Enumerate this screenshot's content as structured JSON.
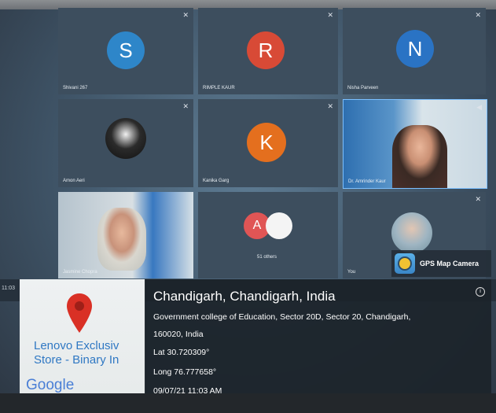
{
  "participants": [
    {
      "initial": "S",
      "name": "Shivani 267",
      "color": "#2e86c9"
    },
    {
      "initial": "R",
      "name": "RIMPLE KAUR",
      "color": "#d84a36"
    },
    {
      "initial": "N",
      "name": "Nisha Parveen",
      "color": "#2a73c4"
    },
    {
      "initial": "",
      "name": "Amon Aeri",
      "color": "#2b2b2b"
    },
    {
      "initial": "K",
      "name": "Kanika Garg",
      "color": "#e46f1e"
    },
    {
      "initial": "",
      "name": "Dr. Amrinder Kaur",
      "color": "#b0c4d6"
    },
    {
      "initial": "",
      "name": "Jasmine Chopra",
      "color": "#c8c0b0"
    },
    {
      "initial": "A",
      "name": "51 others",
      "color": "#e05555"
    },
    {
      "initial": "",
      "name": "You",
      "color": "#b9cbd6"
    }
  ],
  "gps": {
    "app_name": "GPS Map Camera",
    "city": "Chandigarh, Chandigarh, India",
    "address_line1": "Government college of Education, Sector 20D, Sector 20, Chandigarh,",
    "address_line2": "160020, India",
    "lat": "Lat 30.720309°",
    "long": "Long 76.777658°",
    "datetime": "09/07/21 11:03 AM",
    "info_icon": "info-icon"
  },
  "map": {
    "place_line1": "Lenovo Exclusiv",
    "place_line2": "Store - Binary In",
    "brand": "Google",
    "pin_color": "#d93025"
  },
  "taskbar_time": "11:03"
}
